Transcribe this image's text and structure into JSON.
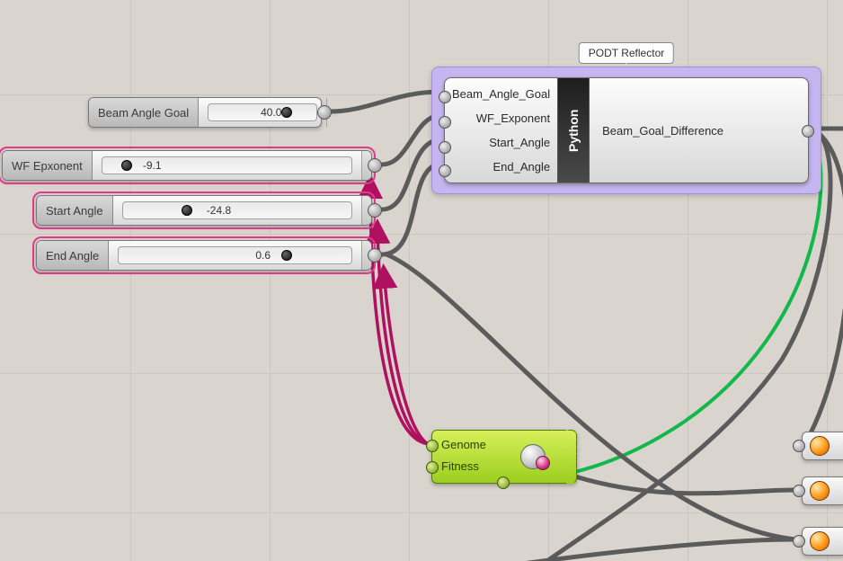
{
  "canvas": {
    "app": "Grasshopper",
    "grid_spacing_px": 155
  },
  "group": {
    "label": "PODT Reflector",
    "color": "#c6b6f0"
  },
  "python_component": {
    "name": "Python",
    "inputs": [
      "Beam_Angle_Goal",
      "WF_Exponent",
      "Start_Angle",
      "End_Angle"
    ],
    "outputs": [
      "Beam_Goal_Difference"
    ]
  },
  "sliders": {
    "beam_angle_goal": {
      "label": "Beam Angle Goal",
      "value": "40.0",
      "knob_pct": 72,
      "selected": false
    },
    "wf_exponent": {
      "label": "WF Epxonent",
      "value": "-9.1",
      "knob_pct": 10,
      "selected": true
    },
    "start_angle": {
      "label": "Start Angle",
      "value": "-24.8",
      "knob_pct": 28,
      "selected": true
    },
    "end_angle": {
      "label": "End Angle",
      "value": "0.6",
      "knob_pct": 72,
      "selected": true
    }
  },
  "galapagos": {
    "genome_label": "Genome",
    "fitness_label": "Fitness"
  },
  "wire_colors": {
    "default": "#5b5b5b",
    "selected": "#b01060",
    "fitness": "#12b84a"
  }
}
